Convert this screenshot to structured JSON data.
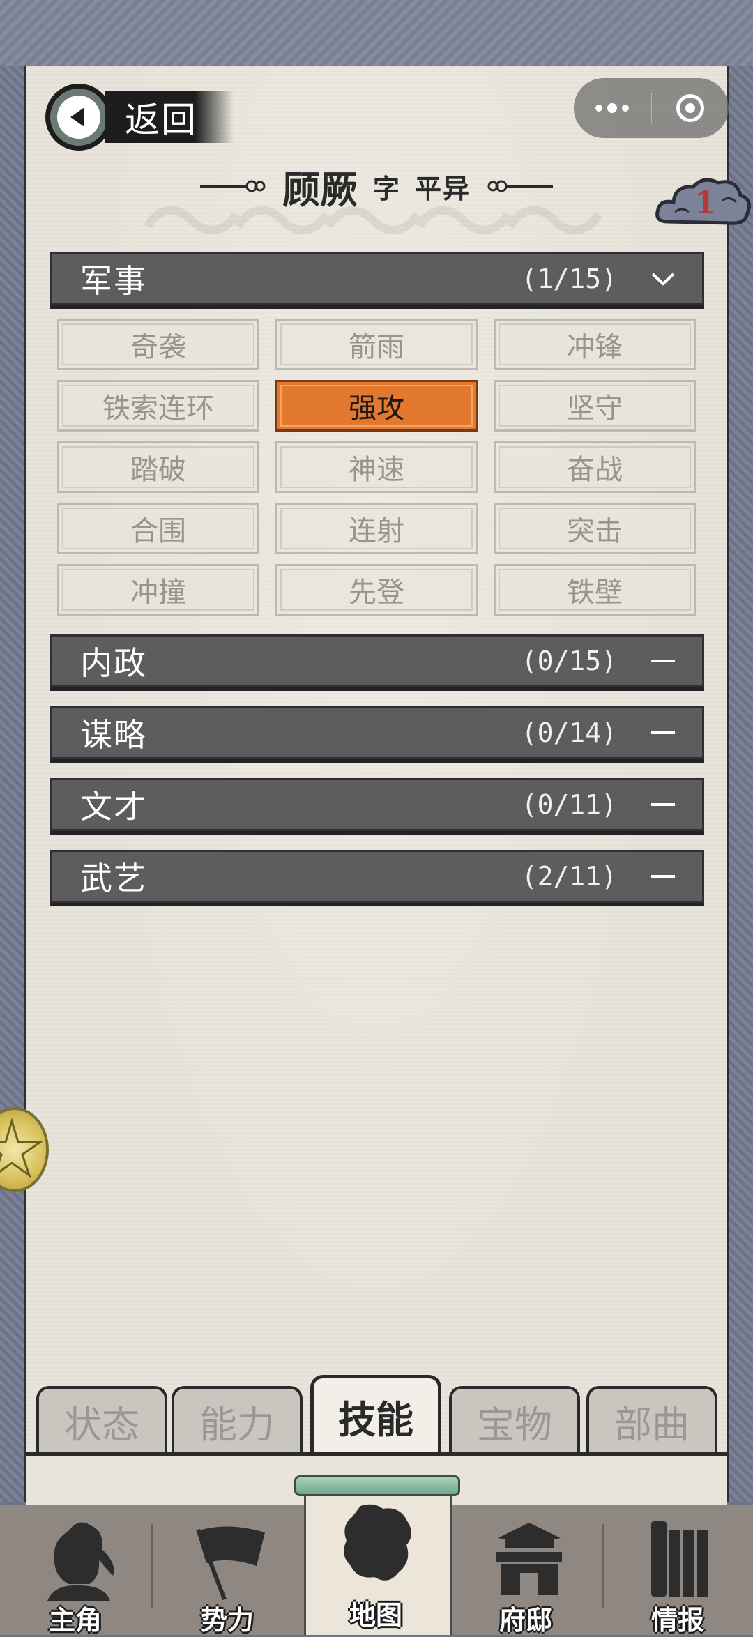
{
  "header": {
    "back_label": "返回",
    "name": "顾厥",
    "zi_label": "字",
    "courtesy_name": "平异",
    "cloud_badge_count": "1"
  },
  "sections": [
    {
      "label": "军事",
      "count": "(1/15)",
      "expanded": true
    },
    {
      "label": "内政",
      "count": "(0/15)",
      "expanded": false
    },
    {
      "label": "谋略",
      "count": "(0/14)",
      "expanded": false
    },
    {
      "label": "文才",
      "count": "(0/11)",
      "expanded": false
    },
    {
      "label": "武艺",
      "count": "(2/11)",
      "expanded": false
    }
  ],
  "military_skills": [
    {
      "label": "奇袭",
      "selected": false
    },
    {
      "label": "箭雨",
      "selected": false
    },
    {
      "label": "冲锋",
      "selected": false
    },
    {
      "label": "铁索连环",
      "selected": false
    },
    {
      "label": "强攻",
      "selected": true
    },
    {
      "label": "坚守",
      "selected": false
    },
    {
      "label": "踏破",
      "selected": false
    },
    {
      "label": "神速",
      "selected": false
    },
    {
      "label": "奋战",
      "selected": false
    },
    {
      "label": "合围",
      "selected": false
    },
    {
      "label": "连射",
      "selected": false
    },
    {
      "label": "突击",
      "selected": false
    },
    {
      "label": "冲撞",
      "selected": false
    },
    {
      "label": "先登",
      "selected": false
    },
    {
      "label": "铁壁",
      "selected": false
    }
  ],
  "content_tabs": [
    {
      "label": "状态",
      "active": false
    },
    {
      "label": "能力",
      "active": false
    },
    {
      "label": "技能",
      "active": true
    },
    {
      "label": "宝物",
      "active": false
    },
    {
      "label": "部曲",
      "active": false
    }
  ],
  "bottom_nav": [
    {
      "label": "主角",
      "icon": "hero-icon",
      "active": false
    },
    {
      "label": "势力",
      "icon": "flag-icon",
      "active": false
    },
    {
      "label": "地图",
      "icon": "map-icon",
      "active": true
    },
    {
      "label": "府邸",
      "icon": "mansion-icon",
      "active": false
    },
    {
      "label": "情报",
      "icon": "scroll-icon",
      "active": false
    }
  ],
  "colors": {
    "selected_skill": "#e2792f",
    "section_header": "#5d5d5f",
    "paper": "#e8e4da",
    "badge_number": "#b13b3b"
  }
}
